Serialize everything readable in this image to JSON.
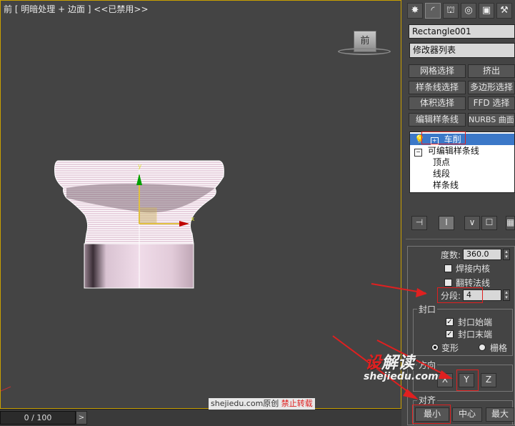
{
  "viewport": {
    "label": "前 [ 明暗处理 + 边面 ] <<已禁用>>",
    "viewcube_label": "前",
    "gizmo_x": "x",
    "gizmo_y": "y"
  },
  "timeline": {
    "frame": "0 / 100",
    "next": ">"
  },
  "panel": {
    "tabs": [
      "✸",
      "◜",
      "⛫",
      "◎",
      "▣",
      "⚒"
    ],
    "object_name": "Rectangle001",
    "modifier_list": "修改器列表",
    "buttons": [
      "网格选择",
      "挤出",
      "样条线选择",
      "多边形选择",
      "体积选择",
      "FFD 选择",
      "编辑样条线",
      "NURBS 曲面选"
    ],
    "stack": {
      "lathe": "车削",
      "editable_spline": "可编辑样条线",
      "vertex": "顶点",
      "segment": "线段",
      "spline": "样条线"
    },
    "stack_tools": [
      "⊣",
      "I",
      "∨",
      "☐",
      "▦"
    ],
    "params": {
      "degrees_label": "度数:",
      "degrees_value": "360.0",
      "weld_core": "焊接内核",
      "flip_normals": "翻转法线",
      "segments_label": "分段:",
      "segments_value": "4",
      "cap_group": "封口",
      "cap_start": "封口始端",
      "cap_end": "封口末端",
      "morph": "变形",
      "grid": "栅格",
      "direction_group": "方向",
      "dir_x": "X",
      "dir_y": "Y",
      "dir_z": "Z",
      "align_group": "对齐",
      "align_min": "最小",
      "align_center": "中心",
      "align_max": "最大"
    }
  },
  "watermark": {
    "logo_red": "设",
    "logo_rest": "解读",
    "site": "shejiedu.com",
    "footer_site": "shejiedu.com原创",
    "footer_warn": "禁止转载"
  },
  "colors": {
    "viewport_bg": "#444444",
    "active_border": "#c9a000",
    "annotation_red": "#e02020",
    "selection_blue": "#3b78c8"
  }
}
